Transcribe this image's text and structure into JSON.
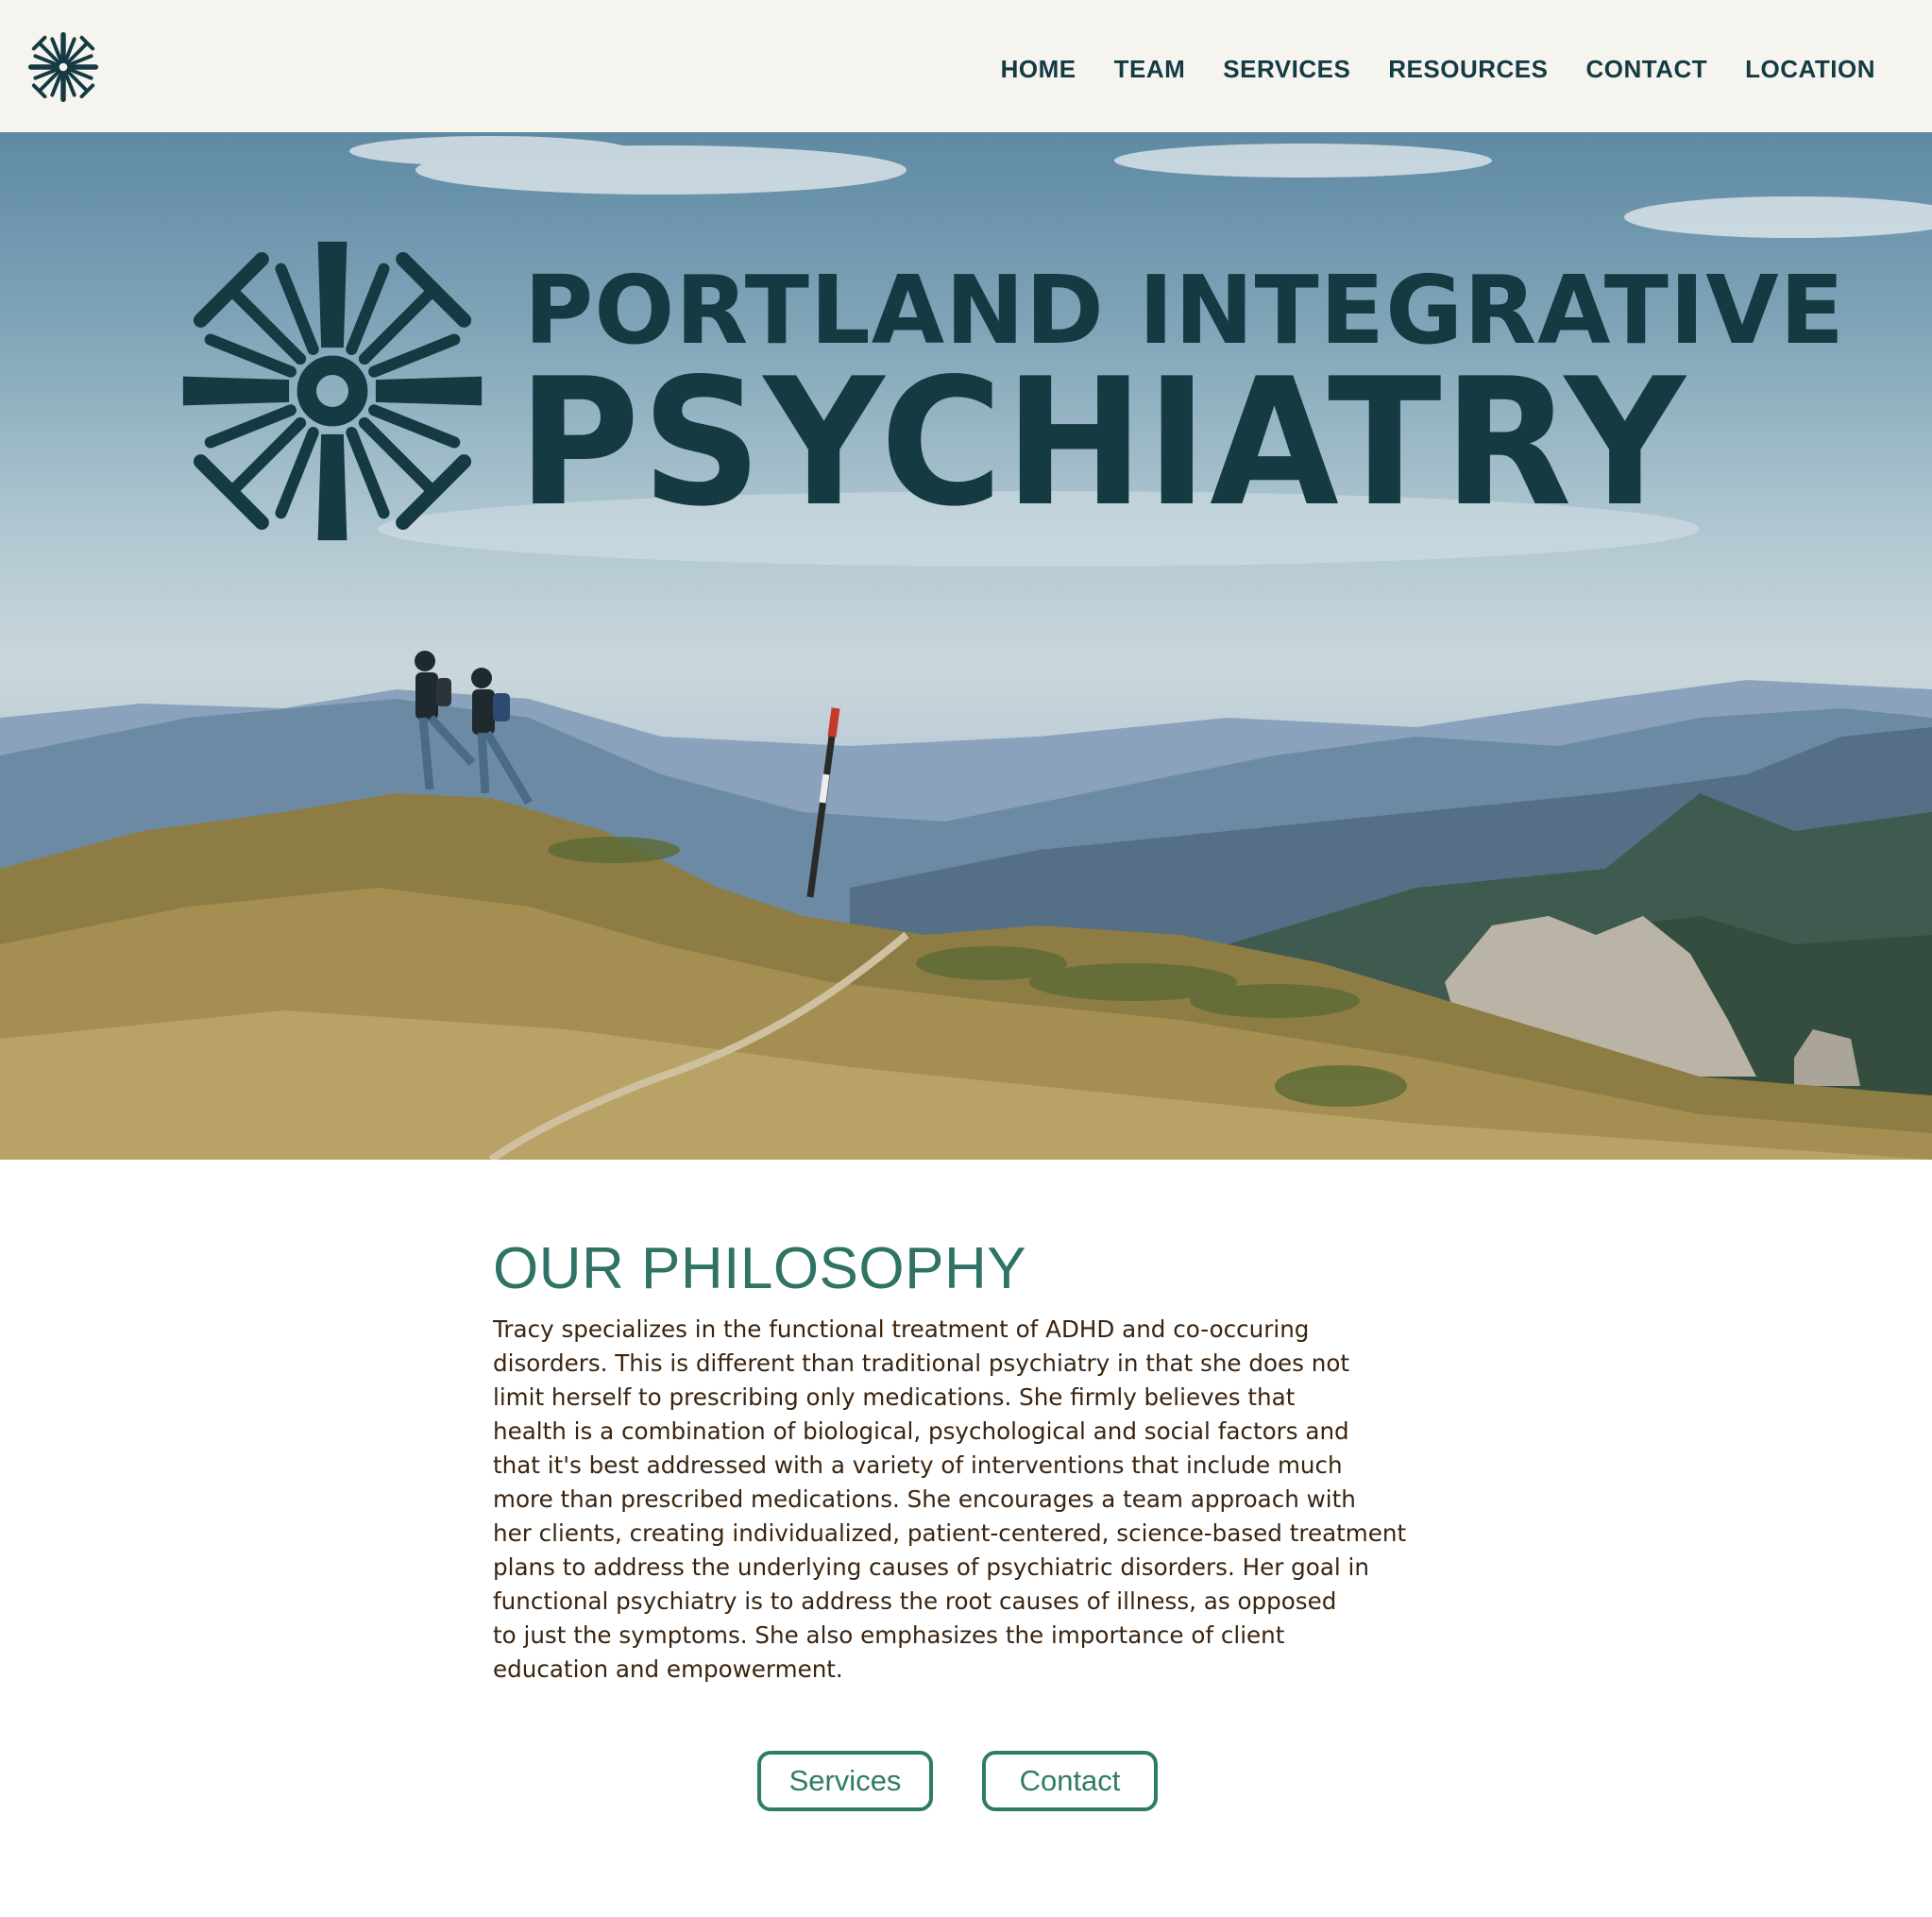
{
  "header": {
    "logo_icon": "sunburst-logo-icon",
    "nav": [
      {
        "label": "HOME"
      },
      {
        "label": "TEAM"
      },
      {
        "label": "SERVICES"
      },
      {
        "label": "RESOURCES"
      },
      {
        "label": "CONTACT"
      },
      {
        "label": "LOCATION"
      }
    ]
  },
  "hero": {
    "title_line1": "PORTLAND INTEGRATIVE",
    "title_line2": "PSYCHIATRY",
    "image_icon": "mountain-hikers-photo",
    "brand_color": "#153a42"
  },
  "philosophy": {
    "title": "OUR PHILOSOPHY",
    "lines": [
      "Tracy specializes in the functional treatment of ADHD and co-occuring",
      "disorders. This is different than traditional psychiatry in that she does not",
      "limit herself to prescribing only medications. She firmly believes that",
      "health is a combination of biological, psychological and social factors and",
      "that it's best addressed with a variety of interventions that include much",
      "more than prescribed medications. She encourages a team approach with",
      "her clients, creating individualized, patient-centered, science-based treatment",
      "plans to address the underlying causes of psychiatric disorders. Her goal in",
      "functional psychiatry is to address the root causes of illness, as opposed",
      "to just the symptoms. She also emphasizes the importance of client",
      "education and empowerment."
    ]
  },
  "buttons": {
    "services_label": "Services",
    "contact_label": "Contact",
    "accent_color": "#2e7d5e"
  }
}
